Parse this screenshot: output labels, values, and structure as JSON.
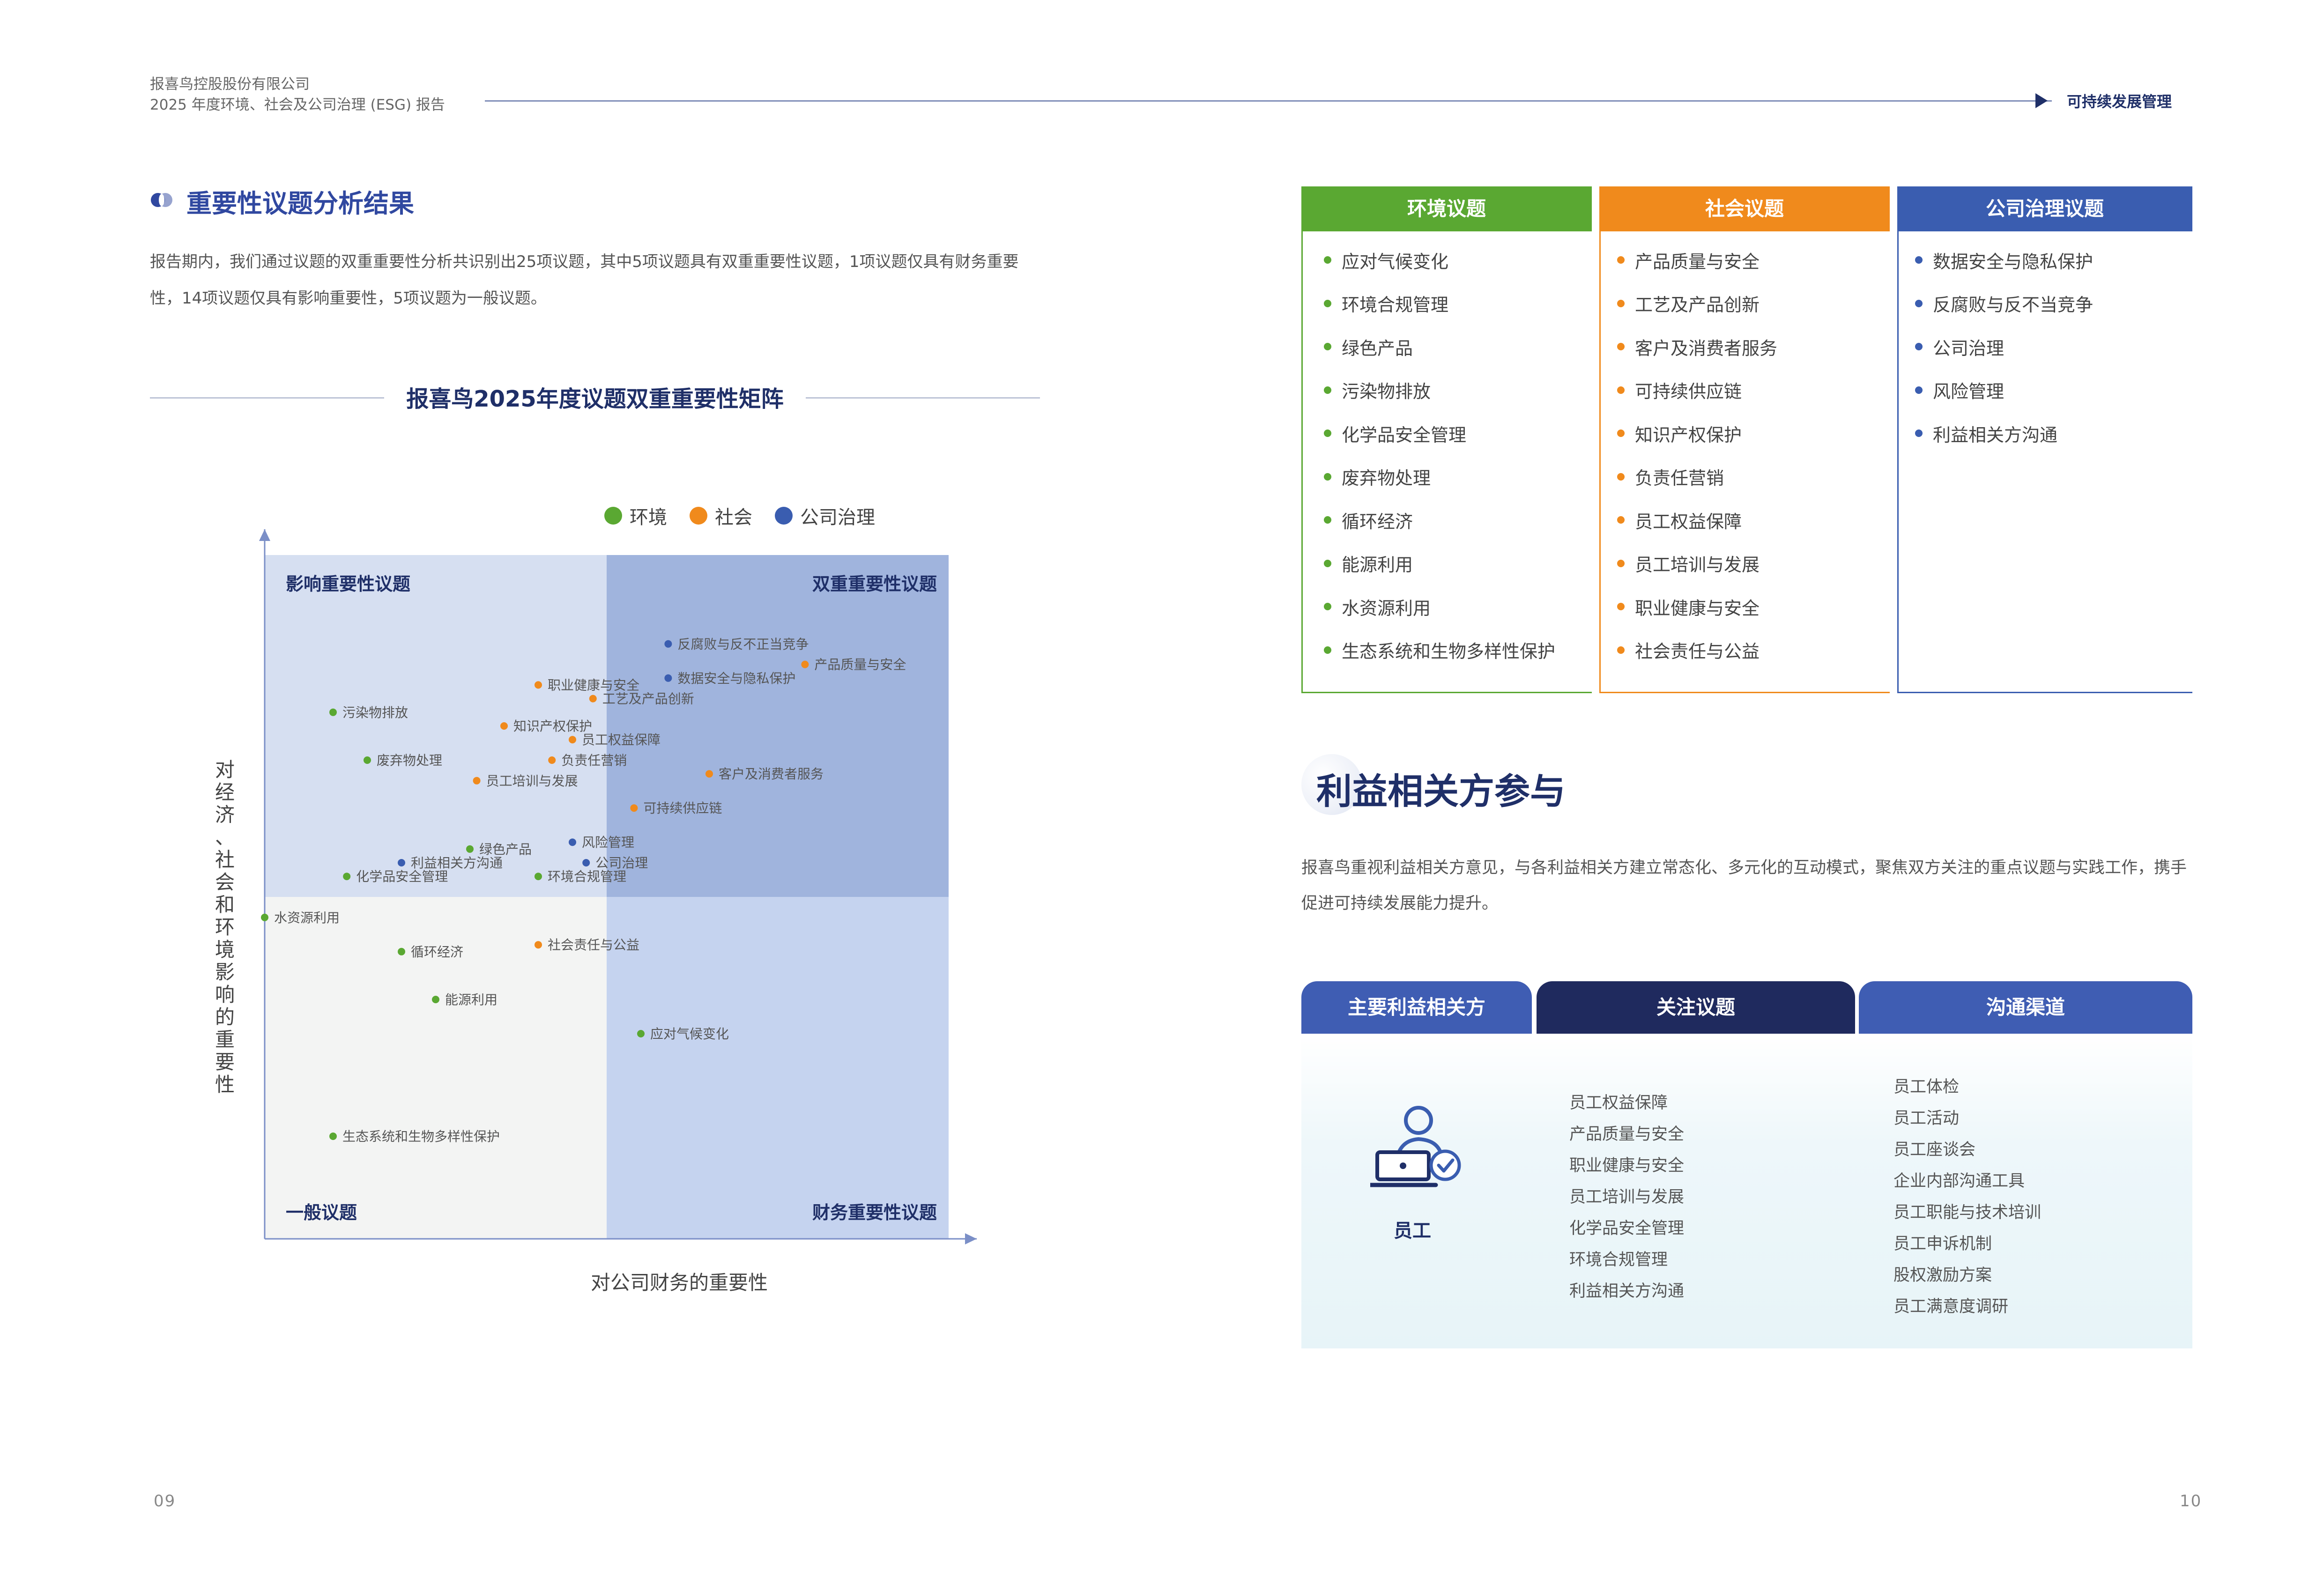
{
  "header": {
    "company": "报喜鸟控股股份有限公司",
    "report": "2025 年度环境、社会及公司治理 (ESG) 报告",
    "section": "可持续发展管理"
  },
  "materiality": {
    "title": "重要性议题分析结果",
    "intro": "报告期内，我们通过议题的双重重要性分析共识别出25项议题，其中5项议题具有双重重要性议题，1项议题仅具有财务重要性，14项议题仅具有影响重要性，5项议题为一般议题。",
    "matrix_title": "报喜鸟2025年度议题双重重要性矩阵"
  },
  "chart_data": {
    "type": "scatter",
    "title": "报喜鸟2025年度议题双重重要性矩阵",
    "xlabel": "对公司财务的重要性",
    "ylabel": "对经济、社会和环境影响的重要性",
    "xlim": [
      0,
      100
    ],
    "ylim": [
      0,
      100
    ],
    "quadrants": {
      "top_left": "影响重要性议题",
      "top_right": "双重重要性议题",
      "bottom_left": "一般议题",
      "bottom_right": "财务重要性议题"
    },
    "legend": [
      {
        "name": "环境",
        "color": "#5aa832"
      },
      {
        "name": "社会",
        "color": "#f08a1c"
      },
      {
        "name": "公司治理",
        "color": "#3a5db0"
      }
    ],
    "points": [
      {
        "label": "反腐败与反不正当竞争",
        "group": "公司治理",
        "x": 59,
        "y": 87
      },
      {
        "label": "产品质量与安全",
        "group": "社会",
        "x": 79,
        "y": 84
      },
      {
        "label": "职业健康与安全",
        "group": "社会",
        "x": 40,
        "y": 81
      },
      {
        "label": "数据安全与隐私保护",
        "group": "公司治理",
        "x": 59,
        "y": 82
      },
      {
        "label": "工艺及产品创新",
        "group": "社会",
        "x": 48,
        "y": 79
      },
      {
        "label": "污染物排放",
        "group": "环境",
        "x": 10,
        "y": 77
      },
      {
        "label": "知识产权保护",
        "group": "社会",
        "x": 35,
        "y": 75
      },
      {
        "label": "员工权益保障",
        "group": "社会",
        "x": 45,
        "y": 73
      },
      {
        "label": "废弃物处理",
        "group": "环境",
        "x": 15,
        "y": 70
      },
      {
        "label": "负责任营销",
        "group": "社会",
        "x": 42,
        "y": 70
      },
      {
        "label": "客户及消费者服务",
        "group": "社会",
        "x": 65,
        "y": 68
      },
      {
        "label": "员工培训与发展",
        "group": "社会",
        "x": 31,
        "y": 67
      },
      {
        "label": "可持续供应链",
        "group": "社会",
        "x": 54,
        "y": 63
      },
      {
        "label": "风险管理",
        "group": "公司治理",
        "x": 45,
        "y": 58
      },
      {
        "label": "绿色产品",
        "group": "环境",
        "x": 30,
        "y": 57
      },
      {
        "label": "公司治理",
        "group": "公司治理",
        "x": 47,
        "y": 55
      },
      {
        "label": "利益相关方沟通",
        "group": "公司治理",
        "x": 20,
        "y": 55
      },
      {
        "label": "化学品安全管理",
        "group": "环境",
        "x": 12,
        "y": 53
      },
      {
        "label": "环境合规管理",
        "group": "环境",
        "x": 40,
        "y": 53
      },
      {
        "label": "水资源利用",
        "group": "环境",
        "x": 0,
        "y": 47
      },
      {
        "label": "社会责任与公益",
        "group": "社会",
        "x": 40,
        "y": 43
      },
      {
        "label": "循环经济",
        "group": "环境",
        "x": 20,
        "y": 42
      },
      {
        "label": "能源利用",
        "group": "环境",
        "x": 25,
        "y": 35
      },
      {
        "label": "应对气候变化",
        "group": "环境",
        "x": 55,
        "y": 30
      },
      {
        "label": "生态系统和生物多样性保护",
        "group": "环境",
        "x": 10,
        "y": 15
      }
    ]
  },
  "categories": [
    {
      "title": "环境议题",
      "color": "#5aa832",
      "items": [
        "应对气候变化",
        "环境合规管理",
        "绿色产品",
        "污染物排放",
        "化学品安全管理",
        "废弃物处理",
        "循环经济",
        "能源利用",
        "水资源利用",
        "生态系统和生物多样性保护"
      ]
    },
    {
      "title": "社会议题",
      "color": "#f08a1c",
      "items": [
        "产品质量与安全",
        "工艺及产品创新",
        "客户及消费者服务",
        "可持续供应链",
        "知识产权保护",
        "负责任营销",
        "员工权益保障",
        "员工培训与发展",
        "职业健康与安全",
        "社会责任与公益"
      ]
    },
    {
      "title": "公司治理议题",
      "color": "#3a5db0",
      "items": [
        "数据安全与隐私保护",
        "反腐败与反不当竞争",
        "公司治理",
        "风险管理",
        "利益相关方沟通"
      ]
    }
  ],
  "stakeholder": {
    "title": "利益相关方参与",
    "intro": "报喜鸟重视利益相关方意见，与各利益相关方建立常态化、多元化的互动模式，聚焦双方关注的重点议题与实践工作，携手促进可持续发展能力提升。",
    "tabs": [
      "主要利益相关方",
      "关注议题",
      "沟通渠道"
    ],
    "employee": {
      "name": "员工",
      "topics": [
        "员工权益保障",
        "产品质量与安全",
        "职业健康与安全",
        "员工培训与发展",
        "化学品安全管理",
        "环境合规管理",
        "利益相关方沟通"
      ],
      "channels": [
        "员工体检",
        "员工活动",
        "员工座谈会",
        "企业内部沟通工具",
        "员工职能与技术培训",
        "员工申诉机制",
        "股权激励方案",
        "员工满意度调研"
      ]
    }
  },
  "pages": {
    "left": "09",
    "right": "10"
  }
}
